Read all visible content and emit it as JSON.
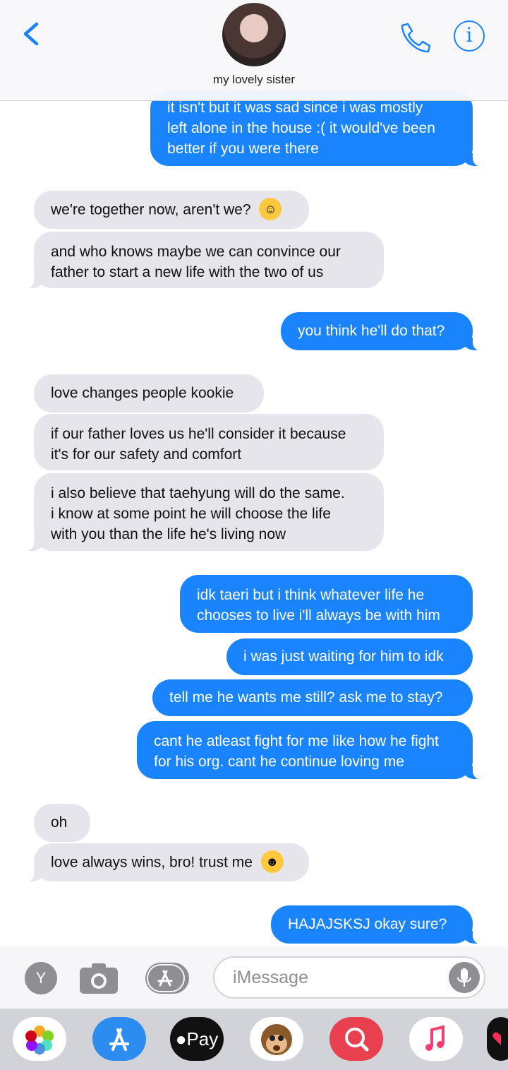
{
  "header": {
    "contact_name": "my lovely sister"
  },
  "messages": [
    {
      "dir": "out",
      "lines": [
        "it isn't but it was sad since i was mostly",
        "left alone in the house :( it would've been",
        "better if you were there"
      ]
    },
    {
      "dir": "in",
      "text": "we're together now, aren't we?",
      "emoji": "smiling-face-with-hearts"
    },
    {
      "dir": "in",
      "lines": [
        "and who knows maybe we can convince our",
        "father to start a new life with the two of us"
      ]
    },
    {
      "dir": "out",
      "text": "you think he'll do that?"
    },
    {
      "dir": "in",
      "text": "love changes people kookie"
    },
    {
      "dir": "in",
      "lines": [
        "if our father loves us he'll consider it because",
        "it's for our safety and comfort"
      ]
    },
    {
      "dir": "in",
      "lines": [
        "i also believe that taehyung will do the same.",
        "i know at some point he will choose the life",
        "with you than the life he's living now"
      ]
    },
    {
      "dir": "out",
      "lines": [
        "idk taeri but i think whatever life he",
        "chooses to live i'll always be with him"
      ]
    },
    {
      "dir": "out",
      "text": "i was just waiting for him to idk"
    },
    {
      "dir": "out",
      "text": "tell me he wants me still? ask me to stay?"
    },
    {
      "dir": "out",
      "lines": [
        "cant he atleast fight for me like how he fight",
        "for his org. cant he continue loving me"
      ]
    },
    {
      "dir": "in",
      "text": "oh"
    },
    {
      "dir": "in",
      "text": "love always wins, bro! trust me",
      "emoji": "winking-face"
    },
    {
      "dir": "out",
      "text": "HAJAJSKSJ okay sure?"
    }
  ],
  "input": {
    "y_label": "Y",
    "placeholder": "iMessage"
  },
  "drawer": {
    "apple_pay_label": "Pay",
    "pay_text": "Pay"
  },
  "colors": {
    "outgoing": "#1a84ff",
    "incoming": "#e6e5eb",
    "accent": "#1a84ff"
  }
}
